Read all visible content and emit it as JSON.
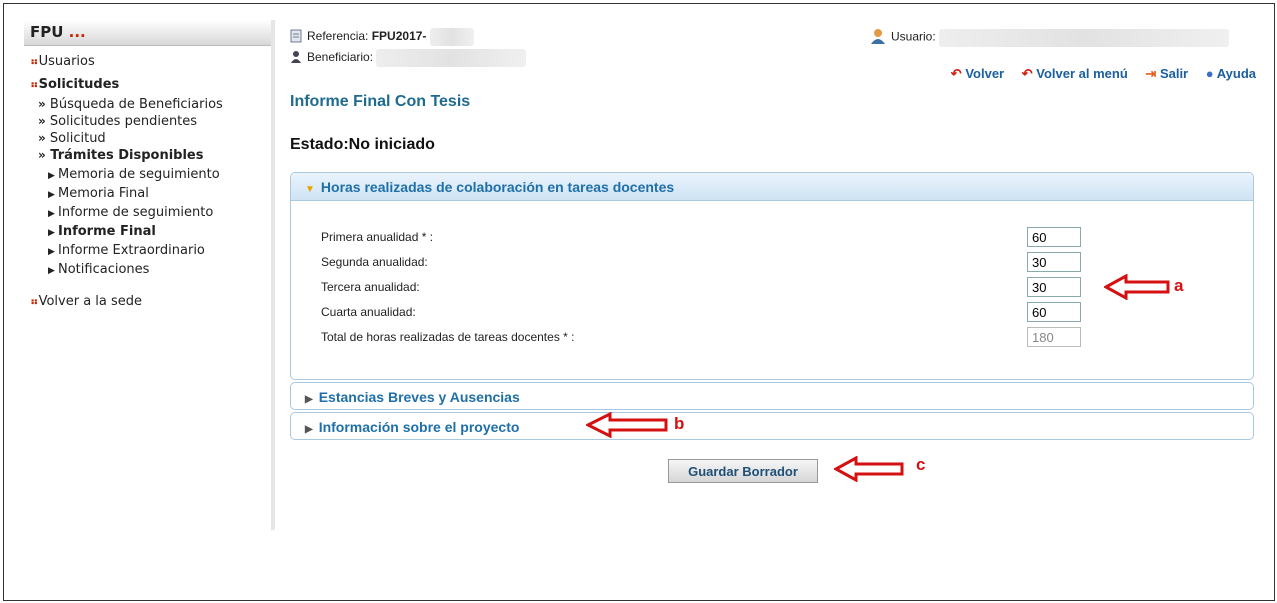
{
  "sidebar": {
    "app": "FPU",
    "dots": "...",
    "usuarios": "Usuarios",
    "solicitudes": "Solicitudes",
    "busqueda": "Búsqueda de Beneficiarios",
    "pendientes": "Solicitudes pendientes",
    "solicitud": "Solicitud",
    "tramites": "Trámites Disponibles",
    "items": [
      "Memoria de seguimiento",
      "Memoria Final",
      "Informe de seguimiento",
      "Informe Final",
      "Informe Extraordinario",
      "Notificaciones"
    ],
    "volver_sede": "Volver a la sede"
  },
  "header": {
    "referencia_label": "Referencia:",
    "referencia_value": "FPU2017-",
    "beneficiario_label": "Beneficiario:",
    "usuario_label": "Usuario:",
    "links": {
      "volver": "Volver",
      "volver_menu": "Volver al menú",
      "salir": "Salir",
      "ayuda": "Ayuda"
    }
  },
  "page": {
    "title": "Informe Final Con Tesis",
    "estado": "Estado:No iniciado"
  },
  "panel_horas": {
    "title": "Horas realizadas de colaboración en tareas docentes",
    "rows": [
      {
        "label": "Primera anualidad * :",
        "value": "60"
      },
      {
        "label": "Segunda anualidad:",
        "value": "30"
      },
      {
        "label": "Tercera anualidad:",
        "value": "30"
      },
      {
        "label": "Cuarta anualidad:",
        "value": "60"
      },
      {
        "label": "Total de horas realizadas de tareas docentes * :",
        "value": "180"
      }
    ]
  },
  "panel_estancias": {
    "title": "Estancias Breves y Ausencias"
  },
  "panel_info": {
    "title": "Información sobre el proyecto"
  },
  "save_button": "Guardar Borrador",
  "annotations": {
    "a": "a",
    "b": "b",
    "c": "c"
  },
  "colors": {
    "accent": "#1f6fa8",
    "title": "#1e6b8f",
    "annotation": "#d41010"
  }
}
